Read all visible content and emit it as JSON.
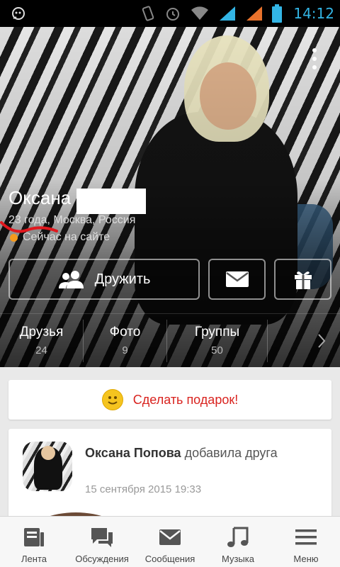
{
  "status_bar": {
    "time": "14:12",
    "icons": [
      "notification-icon",
      "vibrate-icon",
      "alarm-icon",
      "wifi-icon",
      "signal-icon",
      "signal-icon-2",
      "battery-icon"
    ]
  },
  "profile": {
    "name": "Оксана",
    "meta": "23 года, Москва, Россия",
    "online_status": "Сейчас на сайте",
    "buttons": {
      "friend_label": "Дружить",
      "message_icon": "envelope-icon",
      "gift_icon": "gift-icon"
    },
    "stats": [
      {
        "label": "Друзья",
        "value": "24"
      },
      {
        "label": "Фото",
        "value": "9"
      },
      {
        "label": "Группы",
        "value": "50"
      }
    ]
  },
  "gift_card": {
    "label": "Сделать подарок!",
    "icon": "smiley-icon"
  },
  "feed": {
    "author": "Оксана Попова",
    "action": "добавила друга",
    "date": "15 сентября 2015 19:33"
  },
  "bottom_nav": [
    {
      "label": "Лента",
      "icon": "feed-icon"
    },
    {
      "label": "Обсуждения",
      "icon": "discussions-icon"
    },
    {
      "label": "Сообщения",
      "icon": "messages-icon"
    },
    {
      "label": "Музыка",
      "icon": "music-icon"
    },
    {
      "label": "Меню",
      "icon": "menu-icon"
    }
  ],
  "colors": {
    "status_accent": "#33b5e5",
    "online_dot": "#f59a1e",
    "gift_text": "#d9231f"
  }
}
